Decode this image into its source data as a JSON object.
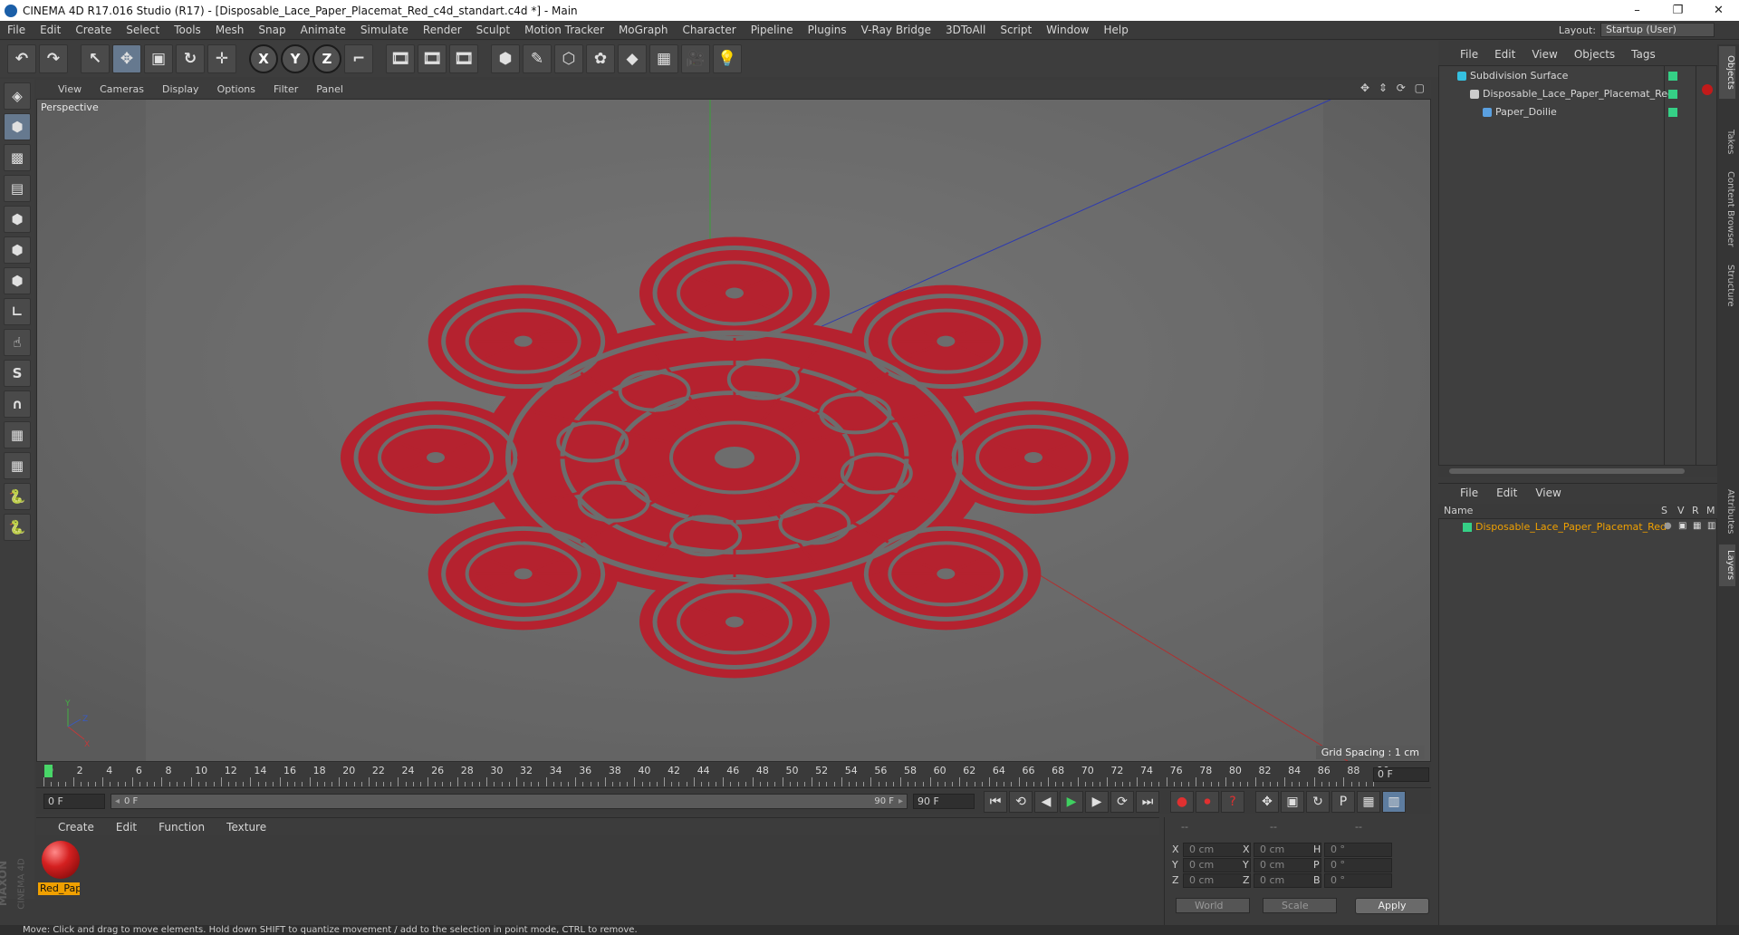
{
  "window": {
    "title": "CINEMA 4D R17.016 Studio (R17) - [Disposable_Lace_Paper_Placemat_Red_c4d_standart.c4d *] - Main",
    "controls": [
      "–",
      "❐",
      "✕"
    ]
  },
  "menu": [
    "File",
    "Edit",
    "Create",
    "Select",
    "Tools",
    "Mesh",
    "Snap",
    "Animate",
    "Simulate",
    "Render",
    "Sculpt",
    "Motion Tracker",
    "MoGraph",
    "Character",
    "Pipeline",
    "Plugins",
    "V-Ray Bridge",
    "3DToAll",
    "Script",
    "Window",
    "Help"
  ],
  "layout": {
    "label": "Layout:",
    "value": "Startup (User)"
  },
  "toolbar": {
    "buttons": [
      {
        "name": "undo-icon",
        "glyph": "↶"
      },
      {
        "name": "redo-icon",
        "glyph": "↷"
      },
      {
        "name": "live-selection-icon",
        "glyph": "↖"
      },
      {
        "name": "move-icon",
        "glyph": "✥"
      },
      {
        "name": "scale-icon",
        "glyph": "▣"
      },
      {
        "name": "rotate-icon",
        "glyph": "↻"
      },
      {
        "name": "transform-icon",
        "glyph": "✛"
      },
      {
        "name": "x-axis-icon",
        "glyph": "X"
      },
      {
        "name": "y-axis-icon",
        "glyph": "Y"
      },
      {
        "name": "z-axis-icon",
        "glyph": "Z"
      },
      {
        "name": "coordinate-system-icon",
        "glyph": "⌐"
      },
      {
        "name": "render-view-icon",
        "glyph": "🎞"
      },
      {
        "name": "render-picture-viewer-icon",
        "glyph": "🎞"
      },
      {
        "name": "render-settings-icon",
        "glyph": "🎞"
      },
      {
        "name": "cube-icon",
        "glyph": "⬢"
      },
      {
        "name": "pen-spline-icon",
        "glyph": "✎"
      },
      {
        "name": "subdivision-surface-icon",
        "glyph": "⬡"
      },
      {
        "name": "mograph-cloner-icon",
        "glyph": "✿"
      },
      {
        "name": "deformer-icon",
        "glyph": "◆"
      },
      {
        "name": "floor-icon",
        "glyph": "▦"
      },
      {
        "name": "camera-icon",
        "glyph": "🎥"
      },
      {
        "name": "light-icon",
        "glyph": "💡"
      }
    ]
  },
  "left_toolbar": [
    {
      "name": "make-editable-icon",
      "glyph": "◈"
    },
    {
      "name": "model-mode-icon",
      "glyph": "⬢"
    },
    {
      "name": "texture-mode-icon",
      "glyph": "▩"
    },
    {
      "name": "workplane-icon",
      "glyph": "▤"
    },
    {
      "name": "points-mode-icon",
      "glyph": "⬢"
    },
    {
      "name": "edges-mode-icon",
      "glyph": "⬢"
    },
    {
      "name": "polygons-mode-icon",
      "glyph": "⬢"
    },
    {
      "name": "axis-icon",
      "glyph": "∟"
    },
    {
      "name": "tweak-icon",
      "glyph": "☝"
    },
    {
      "name": "snap-icon",
      "glyph": "S"
    },
    {
      "name": "magnet-icon",
      "glyph": "∩"
    },
    {
      "name": "lock-workplane-icon",
      "glyph": "▦"
    },
    {
      "name": "planar-workplane-icon",
      "glyph": "▦"
    },
    {
      "name": "python-icon",
      "glyph": "🐍"
    },
    {
      "name": "python-script-icon",
      "glyph": "🐍"
    }
  ],
  "viewport": {
    "menu": [
      "View",
      "Cameras",
      "Display",
      "Options",
      "Filter",
      "Panel"
    ],
    "nav_icons": "✥ ⇕ ⟳ ▢",
    "label": "Perspective",
    "grid_spacing": "Grid Spacing : 1 cm",
    "axis_labels": {
      "y": "Y",
      "z": "Z",
      "x": "X"
    },
    "doily_color": "#b5222f",
    "axis_colors": {
      "x": "#b03030",
      "y": "#3aa03a",
      "z": "#2d3ab0"
    }
  },
  "timeline": {
    "ticks": [
      "0",
      "2",
      "4",
      "6",
      "8",
      "10",
      "12",
      "14",
      "16",
      "18",
      "20",
      "22",
      "24",
      "26",
      "28",
      "30",
      "32",
      "34",
      "36",
      "38",
      "40",
      "42",
      "44",
      "46",
      "48",
      "50",
      "52",
      "54",
      "56",
      "58",
      "60",
      "62",
      "64",
      "66",
      "68",
      "70",
      "72",
      "74",
      "76",
      "78",
      "80",
      "82",
      "84",
      "86",
      "88",
      "90"
    ],
    "current_frame": "0 F"
  },
  "transport": {
    "start": "0 F",
    "range_start": "0 F",
    "range_end": "90 F",
    "end": "90 F",
    "buttons": [
      {
        "name": "go-to-start-icon",
        "glyph": "⏮"
      },
      {
        "name": "prev-key-icon",
        "glyph": "⟲"
      },
      {
        "name": "prev-frame-icon",
        "glyph": "◀"
      },
      {
        "name": "play-icon",
        "glyph": "▶"
      },
      {
        "name": "next-frame-icon",
        "glyph": "▶"
      },
      {
        "name": "next-key-icon",
        "glyph": "⟳"
      },
      {
        "name": "go-to-end-icon",
        "glyph": "⏭"
      },
      {
        "name": "record-icon",
        "glyph": "●"
      },
      {
        "name": "autokey-icon",
        "glyph": "⏺"
      },
      {
        "name": "keyframe-help-icon",
        "glyph": "?"
      },
      {
        "name": "key-position-icon",
        "glyph": "✥"
      },
      {
        "name": "key-scale-icon",
        "glyph": "▣"
      },
      {
        "name": "key-rotation-icon",
        "glyph": "↻"
      },
      {
        "name": "key-parameter-icon",
        "glyph": "P"
      },
      {
        "name": "key-pla-icon",
        "glyph": "▦"
      },
      {
        "name": "timeline-icon",
        "glyph": "▥"
      }
    ]
  },
  "material_manager": {
    "menu": [
      "Create",
      "Edit",
      "Function",
      "Texture"
    ],
    "material_name": "Red_Pap"
  },
  "coordinates": {
    "header": [
      "--",
      "--",
      "--"
    ],
    "rows": [
      {
        "a": "X",
        "av": "0 cm",
        "b": "X",
        "bv": "0 cm",
        "c": "H",
        "cv": "0 °"
      },
      {
        "a": "Y",
        "av": "0 cm",
        "b": "Y",
        "bv": "0 cm",
        "c": "P",
        "cv": "0 °"
      },
      {
        "a": "Z",
        "av": "0 cm",
        "b": "Z",
        "bv": "0 cm",
        "c": "B",
        "cv": "0 °"
      }
    ],
    "mode": "World",
    "transform": "Scale",
    "apply": "Apply"
  },
  "object_manager": {
    "menu": [
      "File",
      "Edit",
      "View",
      "Objects",
      "Tags"
    ],
    "objects": [
      {
        "name": "Subdivision Surface",
        "indent": 0,
        "icon_color": "#35c0e0"
      },
      {
        "name": "Disposable_Lace_Paper_Placemat_Red",
        "indent": 1,
        "icon_color": "#cccccc"
      },
      {
        "name": "Paper_Doilie",
        "indent": 2,
        "icon_color": "#5aa0e0"
      }
    ]
  },
  "layer_manager": {
    "menu": [
      "File",
      "Edit",
      "View"
    ],
    "columns": [
      "Name",
      "S",
      "V",
      "R",
      "M"
    ],
    "layers": [
      {
        "name": "Disposable_Lace_Paper_Placemat_Red",
        "color": "#35d086",
        "text_color": "#f0a000"
      }
    ]
  },
  "side_tabs": [
    "Objects",
    "Takes",
    "Content Browser",
    "Structure",
    "Attributes",
    "Layers"
  ],
  "logo": [
    "MAXON",
    "CINEMA 4D"
  ],
  "status": "Move: Click and drag to move elements. Hold down SHIFT to quantize movement / add to the selection in point mode, CTRL to remove."
}
